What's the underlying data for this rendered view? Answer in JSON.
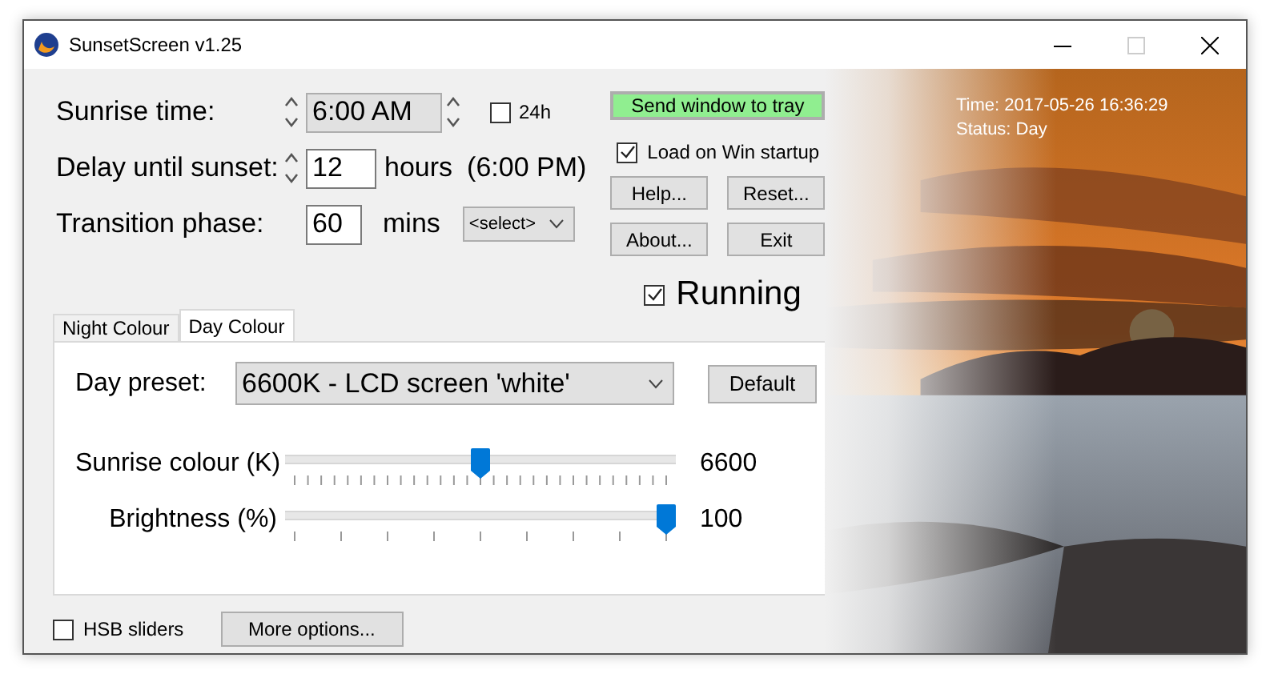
{
  "window": {
    "title": "SunsetScreen v1.25"
  },
  "sunrise_time": {
    "label": "Sunrise time:",
    "value": "6:00 AM",
    "use_24h": {
      "label": "24h",
      "checked": false
    }
  },
  "delay": {
    "label": "Delay until sunset:",
    "value": "12",
    "unit": "hours",
    "note": "(6:00 PM)"
  },
  "transition": {
    "label": "Transition phase:",
    "value": "60",
    "unit": "mins",
    "select": "<select>"
  },
  "tray_button": "Send window to tray",
  "load_on_startup": {
    "label": "Load on Win startup",
    "checked": true
  },
  "actions": [
    {
      "label": "Help..."
    },
    {
      "label": "Reset..."
    },
    {
      "label": "About..."
    },
    {
      "label": "Exit"
    }
  ],
  "running": {
    "label": "Running",
    "checked": true
  },
  "tabs": [
    {
      "label": "Night Colour",
      "selected": false
    },
    {
      "label": "Day Colour",
      "selected": true
    }
  ],
  "day_preset": {
    "label": "Day preset:",
    "value": "6600K - LCD screen 'white'",
    "button": "Default"
  },
  "sliders": [
    {
      "label": "Sunrise colour (K)",
      "level": 0.5,
      "reading": "6600"
    },
    {
      "label": "Brightness (%)",
      "level": 1,
      "reading": "100"
    }
  ],
  "hsb_sliders": {
    "label": "HSB sliders",
    "checked": false
  },
  "more_options": "More options...",
  "status": {
    "time": "Time: 2017-05-26 16:36:29",
    "status": "Status: Day"
  }
}
